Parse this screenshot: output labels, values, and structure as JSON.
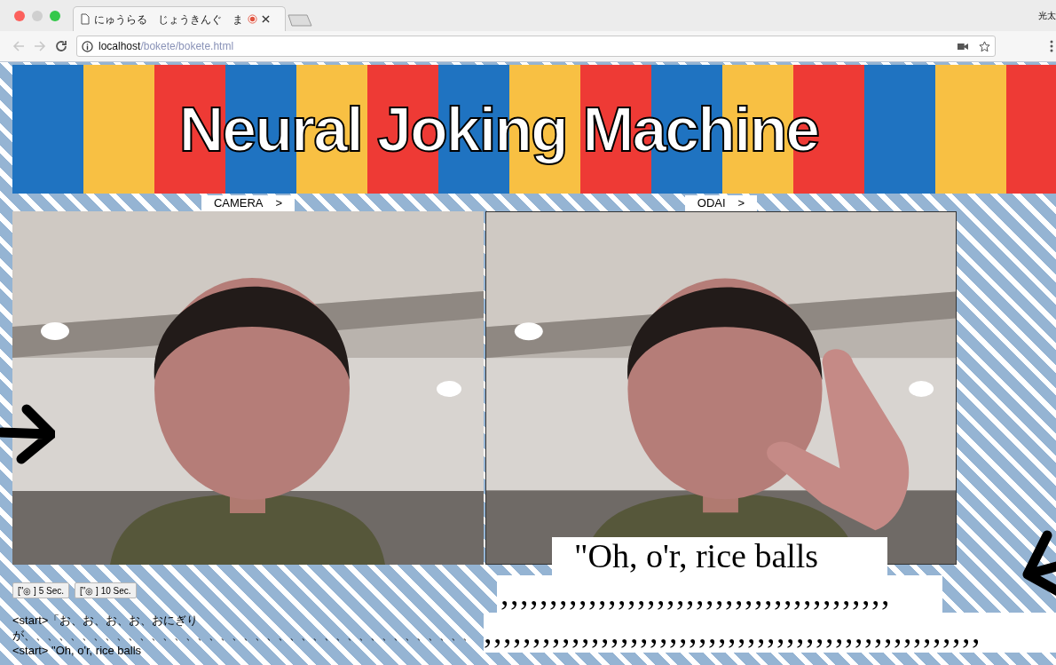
{
  "browser": {
    "tab_title": "にゅうらる　じょうきんぐ　ま",
    "profile": "光太",
    "url_host": "localhost",
    "url_path": "/bokete/bokete.html"
  },
  "banner": {
    "title": "Neural Joking Machine"
  },
  "panels": [
    {
      "label": "CAMERA",
      "arrow": ">",
      "kind": "plain"
    },
    {
      "label": "ODAI",
      "arrow": ">",
      "kind": "hand"
    }
  ],
  "caption_lines": [
    "\"Oh, o'r, rice balls",
    ",,,,,,,,,,,,,,,,,,,,,,,,,,,,,,,,,,,,,,,,",
    ",,,,,,,,,,,,,,,,,,,,,,,,,,,,,,,,,,,,,,,,,,,,,,,,,,,"
  ],
  "timer_buttons": [
    "[\"◎ ] 5 Sec.",
    "[\"◎ ] 10 Sec."
  ],
  "output_lines": [
    "<start>「お、お、お、お、おにぎり",
    "が、、、、、、、、、、、、、、、、、、、、、、、、、、、、、、、、、、、、、、、",
    "<start> \"Oh, o'r, rice balls"
  ]
}
